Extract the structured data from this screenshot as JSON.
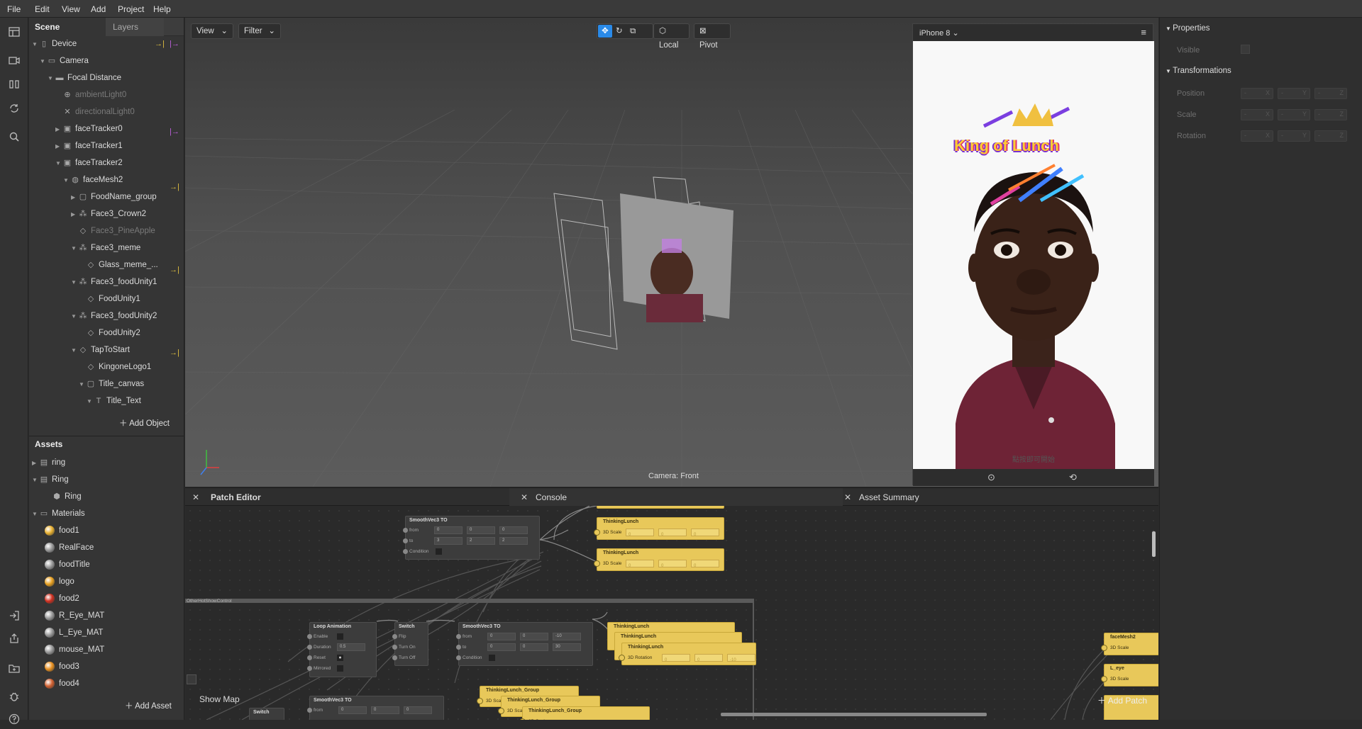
{
  "menu": [
    "File",
    "Edit",
    "View",
    "Add",
    "Project",
    "Help"
  ],
  "scene": {
    "tab_scene": "Scene",
    "tab_layers": "Layers",
    "tree": [
      {
        "label": "Device",
        "icon": "device-icon",
        "arrow": "down",
        "indent": 0,
        "dim": false
      },
      {
        "label": "Camera",
        "icon": "camera-icon",
        "arrow": "down",
        "indent": 1,
        "dim": false
      },
      {
        "label": "Focal Distance",
        "icon": "focal-distance-icon",
        "arrow": "down",
        "indent": 2,
        "dim": false
      },
      {
        "label": "ambientLight0",
        "icon": "ambient-light-icon",
        "arrow": "",
        "indent": 3,
        "dim": true
      },
      {
        "label": "directionalLight0",
        "icon": "directional-light-icon",
        "arrow": "",
        "indent": 3,
        "dim": true
      },
      {
        "label": "faceTracker0",
        "icon": "face-tracker-icon",
        "arrow": "right",
        "indent": 3,
        "dim": false
      },
      {
        "label": "faceTracker1",
        "icon": "face-tracker-icon",
        "arrow": "right",
        "indent": 3,
        "dim": false
      },
      {
        "label": "faceTracker2",
        "icon": "face-tracker-icon",
        "arrow": "down",
        "indent": 3,
        "dim": false
      },
      {
        "label": "faceMesh2",
        "icon": "face-mesh-icon",
        "arrow": "down",
        "indent": 4,
        "dim": false
      },
      {
        "label": "FoodName_group",
        "icon": "canvas-icon",
        "arrow": "right",
        "indent": 5,
        "dim": false
      },
      {
        "label": "Face3_Crown2",
        "icon": "null-object-icon",
        "arrow": "right",
        "indent": 5,
        "dim": false
      },
      {
        "label": "Face3_PineApple",
        "icon": "plane-icon",
        "arrow": "",
        "indent": 5,
        "dim": true
      },
      {
        "label": "Face3_meme",
        "icon": "null-object-icon",
        "arrow": "down",
        "indent": 5,
        "dim": false
      },
      {
        "label": "Glass_meme_...",
        "icon": "plane-icon",
        "arrow": "",
        "indent": 6,
        "dim": false
      },
      {
        "label": "Face3_foodUnity1",
        "icon": "null-object-icon",
        "arrow": "down",
        "indent": 5,
        "dim": false
      },
      {
        "label": "FoodUnity1",
        "icon": "plane-icon",
        "arrow": "",
        "indent": 6,
        "dim": false
      },
      {
        "label": "Face3_foodUnity2",
        "icon": "null-object-icon",
        "arrow": "down",
        "indent": 5,
        "dim": false
      },
      {
        "label": "FoodUnity2",
        "icon": "plane-icon",
        "arrow": "",
        "indent": 6,
        "dim": false
      },
      {
        "label": "TapToStart",
        "icon": "plane-icon",
        "arrow": "down",
        "indent": 5,
        "dim": false
      },
      {
        "label": "KingoneLogo1",
        "icon": "plane-icon",
        "arrow": "",
        "indent": 6,
        "dim": false
      },
      {
        "label": "Title_canvas",
        "icon": "canvas-icon",
        "arrow": "down",
        "indent": 6,
        "dim": false
      },
      {
        "label": "Title_Text",
        "icon": "text-icon",
        "arrow": "down",
        "indent": 7,
        "dim": false
      }
    ],
    "add_object": "Add Object"
  },
  "assets": {
    "title": "Assets",
    "items": [
      {
        "label": "ring",
        "kind": "file",
        "arrow": "right",
        "indent": 0
      },
      {
        "label": "Ring",
        "kind": "file",
        "arrow": "down",
        "indent": 0
      },
      {
        "label": "Ring",
        "kind": "mesh",
        "arrow": "",
        "indent": 1
      },
      {
        "label": "Materials",
        "kind": "folder",
        "arrow": "down",
        "indent": 0
      },
      {
        "label": "food1",
        "kind": "material",
        "color": "#e8b030",
        "indent": 1
      },
      {
        "label": "RealFace",
        "kind": "material",
        "color": "#9a9a9a",
        "indent": 1
      },
      {
        "label": "foodTitle",
        "kind": "material",
        "color": "#9a9a9a",
        "indent": 1
      },
      {
        "label": "logo",
        "kind": "material",
        "color": "#e8a020",
        "indent": 1
      },
      {
        "label": "food2",
        "kind": "material",
        "color": "#d03020",
        "indent": 1
      },
      {
        "label": "R_Eye_MAT",
        "kind": "material",
        "color": "#9a9a9a",
        "indent": 1
      },
      {
        "label": "L_Eye_MAT",
        "kind": "material",
        "color": "#9a9a9a",
        "indent": 1
      },
      {
        "label": "mouse_MAT",
        "kind": "material",
        "color": "#9a9a9a",
        "indent": 1
      },
      {
        "label": "food3",
        "kind": "material",
        "color": "#e89020",
        "indent": 1
      },
      {
        "label": "food4",
        "kind": "material",
        "color": "#d06030",
        "indent": 1
      }
    ],
    "add_asset": "Add Asset"
  },
  "viewport": {
    "view_label": "View",
    "filter_label": "Filter",
    "local_label": "Local",
    "pivot_label": "Pivot",
    "camera_label": "Camera: Front"
  },
  "phone": {
    "device": "iPhone 8",
    "title_overlay": "King of Lunch",
    "tap_text": "點按即可開始"
  },
  "properties": {
    "section_properties": "Properties",
    "visible_label": "Visible",
    "section_transformations": "Transformations",
    "rows": [
      "Position",
      "Scale",
      "Rotation"
    ],
    "axes": [
      "X",
      "Y",
      "Z"
    ],
    "placeholder": "-"
  },
  "bottom_tabs": {
    "patch_editor": "Patch Editor",
    "console": "Console",
    "asset_summary": "Asset Summary"
  },
  "patches": {
    "smooth1": {
      "title": "SmoothVec3 TO",
      "rows": [
        {
          "label": "from",
          "vals": [
            "0",
            "0",
            "0"
          ]
        },
        {
          "label": "to",
          "vals": [
            "3",
            "2",
            "2"
          ]
        },
        {
          "label": "Condition",
          "vals": []
        }
      ]
    },
    "thinking1": {
      "title": "ThinkingLunch",
      "row": "3D Scale",
      "vals": [
        "0",
        "0",
        "0"
      ]
    },
    "thinking2": {
      "title": "ThinkingLunch",
      "row": "3D Scale",
      "vals": [
        "0",
        "0",
        "0"
      ]
    },
    "group_label": "OtherHotShowControl",
    "loop": {
      "title": "Loop Animation",
      "rows": [
        "Enable",
        "Duration",
        "Reset",
        "Mirrored"
      ],
      "duration": "0.5"
    },
    "switch1": {
      "title": "Switch",
      "rows": [
        "Flip",
        "Turn On",
        "Turn Off"
      ]
    },
    "smooth2": {
      "title": "SmoothVec3 TO",
      "rows": [
        {
          "label": "from",
          "vals": [
            "0",
            "0",
            "-10"
          ]
        },
        {
          "label": "to",
          "vals": [
            "0",
            "0",
            "30"
          ]
        },
        {
          "label": "Condition",
          "vals": []
        }
      ]
    },
    "thinking3": {
      "title": "ThinkingLunch"
    },
    "thinking4": {
      "title": "ThinkingLunch"
    },
    "thinking5": {
      "title": "ThinkingLunch",
      "row": "3D Rotation",
      "vals": [
        "0",
        "0",
        "-10"
      ]
    },
    "show_map": "Show Map",
    "smooth3": {
      "title": "SmoothVec3 TO",
      "from": "from",
      "vals": [
        "0",
        "0",
        "0"
      ]
    },
    "switch2": {
      "title": "Switch"
    },
    "tlg1": "ThinkingLunch_Group",
    "tlg2": "ThinkingLunch_Group",
    "tlg3": "ThinkingLunch_Group",
    "tlg_row": "3D Scale",
    "facemesh": {
      "title": "faceMesh2",
      "row": "3D Scale"
    },
    "leye": {
      "title": "L_eye",
      "row": "3D Scale"
    },
    "add_patch": "Add Patch"
  },
  "colors": {
    "accent": "#2a8ae8",
    "patch_yellow": "#e8c85a",
    "arrow_yellow": "#e0c040",
    "arrow_purple": "#c060e0"
  }
}
